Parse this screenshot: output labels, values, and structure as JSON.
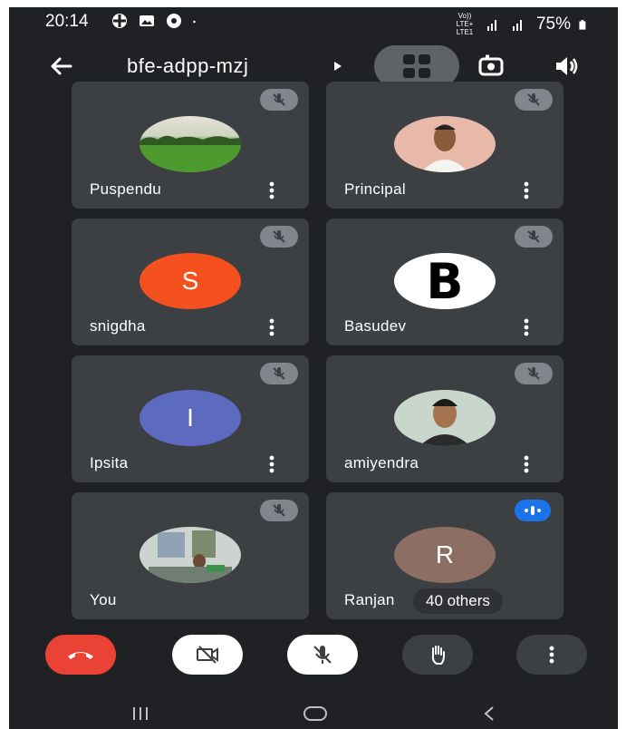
{
  "status_bar": {
    "time": "20:14",
    "network": "Vo)) LTE+ LTE1",
    "battery": "75%"
  },
  "header": {
    "meeting_code": "bfe-adpp-mzj",
    "icons": [
      "back-arrow-icon",
      "caret-right-icon",
      "grid-layout-icon",
      "flip-camera-icon",
      "speaker-icon"
    ]
  },
  "participants": [
    {
      "name": "Puspendu",
      "avatar": "photo",
      "state": "muted"
    },
    {
      "name": "Principal",
      "avatar": "photo",
      "state": "muted"
    },
    {
      "name": "snigdha",
      "avatar": "S",
      "avatar_color": "#f4511e",
      "state": "muted"
    },
    {
      "name": "Basudev",
      "avatar": "B",
      "avatar_color": "#ffffff",
      "state": "muted"
    },
    {
      "name": "Ipsita",
      "avatar": "I",
      "avatar_color": "#5c6bc0",
      "state": "muted"
    },
    {
      "name": "amiyendra",
      "avatar": "photo",
      "state": "muted"
    },
    {
      "name": "You",
      "avatar": "photo",
      "state": "muted"
    },
    {
      "name": "Ranjan",
      "avatar": "R",
      "avatar_color": "#8d6e63",
      "state": "speaking",
      "overlay": "40 others"
    }
  ],
  "controls": {
    "end_call_color": "#ea4335",
    "icons": [
      "end-call-icon",
      "camera-off-icon",
      "mic-off-icon",
      "raise-hand-icon",
      "more-options-icon"
    ]
  },
  "colors": {
    "background": "#202124",
    "tile": "#3c4043",
    "speaking": "#1a73e8"
  }
}
